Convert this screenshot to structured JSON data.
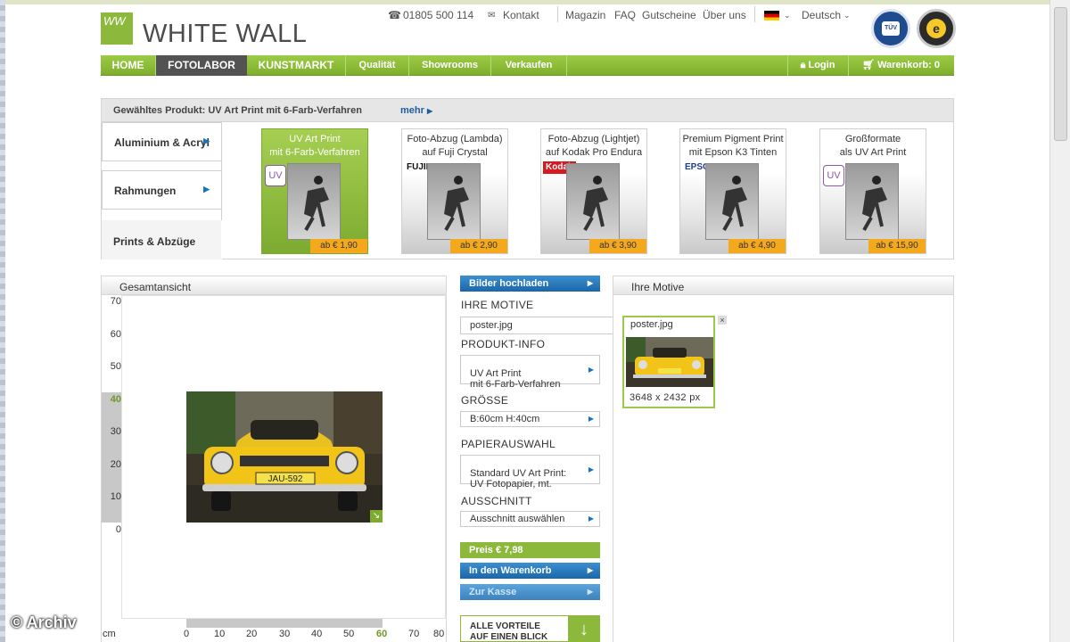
{
  "logo": {
    "mark": "WW",
    "name": "WHITE WALL"
  },
  "topbar": {
    "phone": "01805 500 114",
    "contact": "Kontakt",
    "links": [
      "Magazin",
      "FAQ",
      "Gutscheine",
      "Über uns"
    ],
    "language": "Deutsch"
  },
  "nav": {
    "items": [
      "HOME",
      "FOTOLABOR",
      "KUNSTMARKT",
      "Qualität",
      "Showrooms",
      "Verkaufen"
    ],
    "login": "Login",
    "cart": "Warenkorb: 0"
  },
  "product": {
    "selected_label": "Gewähltes Produkt: UV Art Print mit 6-Farb-Verfahren",
    "more": "mehr",
    "categories": [
      "Aluminium & Acryl",
      "Rahmungen",
      "Prints & Abzüge"
    ],
    "cards": [
      {
        "title": "UV Art Print\nmit 6-Farb-Verfahren",
        "price": "ab € 1,90",
        "brand": "UV"
      },
      {
        "title": "Foto-Abzug (Lambda)\nauf Fuji Crystal",
        "price": "ab € 2,90",
        "brand": "FUJIFILM"
      },
      {
        "title": "Foto-Abzug (Lightjet)\nauf Kodak Pro Endura",
        "price": "ab € 3,90",
        "brand": "Kodak"
      },
      {
        "title": "Premium Pigment Print\nmit Epson K3 Tinten",
        "price": "ab € 4,90",
        "brand": "EPSON"
      },
      {
        "title": "Großformate\nals UV Art Print",
        "price": "ab € 15,90",
        "brand": "UV"
      }
    ]
  },
  "preview": {
    "title": "Gesamtansicht",
    "y_ticks": [
      "70",
      "60",
      "50",
      "40",
      "30",
      "20",
      "10",
      "0"
    ],
    "x_ticks": [
      "0",
      "10",
      "20",
      "30",
      "40",
      "50",
      "60",
      "70",
      "80"
    ],
    "unit": "cm",
    "selected_width_cm": 60,
    "selected_height_cm": 40
  },
  "config": {
    "upload": "Bilder hochladen",
    "motive_label": "IHRE MOTIVE",
    "motive_value": "poster.jpg",
    "product_label": "PRODUKT-INFO",
    "product_value": "UV Art Print\nmit 6-Farb-Verfahren",
    "size_label": "GRÖSSE",
    "size_value": "B:60cm H:40cm",
    "paper_label": "PAPIERAUSWAHL",
    "paper_value": "Standard UV Art Print:\nUV Fotopapier, mt.",
    "crop_label": "AUSSCHNITT",
    "crop_value": "Ausschnitt auswählen",
    "price": "Preis  € 7,98",
    "add_to_cart": "In den Warenkorb",
    "checkout": "Zur Kasse",
    "advantages": "ALLE VORTEILE\nAUF EINEN BLICK"
  },
  "motifs": {
    "title": "Ihre Motive",
    "filename": "poster.jpg",
    "dimensions": "3648 x 2432 px"
  },
  "watermark": "© Archiv",
  "colors": {
    "brand_green": "#8cb83c",
    "nav_active": "#535353",
    "button_blue": "#1a66a8",
    "price_orange": "#f4a81c"
  }
}
